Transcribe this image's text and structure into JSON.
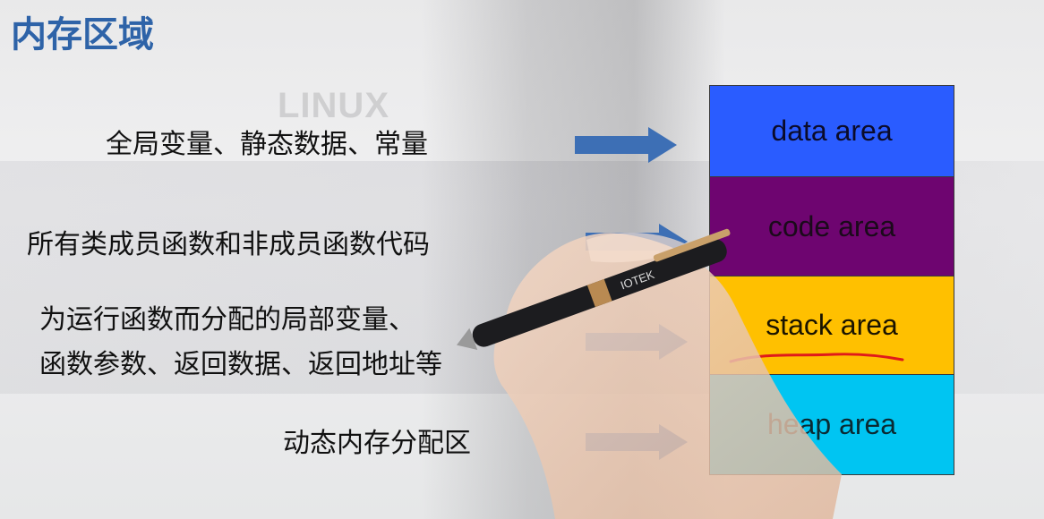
{
  "title": "内存区域",
  "watermark": "LINUX",
  "pen_brand": "IOTEK",
  "labels": {
    "data": "全局变量、静态数据、常量",
    "code": "所有类成员函数和非成员函数代码",
    "stack_line1": "为运行函数而分配的局部变量、",
    "stack_line2": "函数参数、返回数据、返回地址等",
    "heap": "动态内存分配区"
  },
  "blocks": [
    {
      "label": "data area",
      "color": "#2a5cff",
      "text_color": "#0b0b2a"
    },
    {
      "label": "code area",
      "color": "#6e0570",
      "text_color": "#1a0a1a"
    },
    {
      "label": "stack area",
      "color": "#ffc000",
      "text_color": "#1a1400"
    },
    {
      "label": "heap area",
      "color": "#00c5f2",
      "text_color": "#0a2a33"
    }
  ],
  "colors": {
    "title": "#2e63a8",
    "arrow": "#3d6fb5",
    "underline": "#e01a1a"
  }
}
